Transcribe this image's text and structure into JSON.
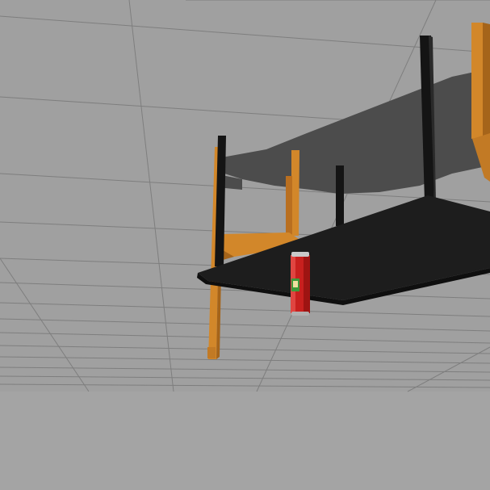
{
  "scene": {
    "description_label": "",
    "colors": {
      "background": "#9e9e9e",
      "ground": "#a3a3a3",
      "grid_line": "#7c7c7c",
      "shadow": "#4a4a4a",
      "table_top": "#1d1d1d",
      "table_leg": "#141414",
      "chair_wood": "#d2872a",
      "chair_wood_dark": "#a5641a",
      "can_red": "#c8201e",
      "can_silver": "#c9c9c9"
    },
    "objects": [
      "table-upside-down",
      "chair-left",
      "chair-right",
      "soda-can"
    ]
  }
}
